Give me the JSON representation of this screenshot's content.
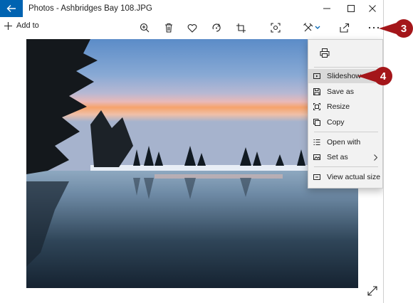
{
  "window": {
    "title": "Photos - Ashbridges Bay 108.JPG"
  },
  "toolbar": {
    "add_to_label": "Add to",
    "icons": [
      "zoom-in-icon",
      "delete-icon",
      "favorite-icon",
      "rotate-icon",
      "crop-icon",
      "enhance-icon",
      "edit-icon",
      "share-icon",
      "more-icon"
    ]
  },
  "menu": {
    "items": [
      {
        "label": "Slideshow",
        "icon": "slideshow-icon"
      },
      {
        "label": "Save as",
        "icon": "save-icon"
      },
      {
        "label": "Resize",
        "icon": "resize-icon"
      },
      {
        "label": "Copy",
        "icon": "copy-icon"
      },
      {
        "label": "Open with",
        "icon": "open-with-icon"
      },
      {
        "label": "Set as",
        "icon": "set-as-icon"
      },
      {
        "label": "View actual size",
        "icon": "actual-size-icon"
      }
    ],
    "highlighted_item": "Slideshow"
  },
  "callouts": {
    "more": "3",
    "slideshow": "4"
  },
  "colors": {
    "accent": "#0063b1",
    "callout": "#a4161a",
    "menu_highlight": "#d9d9d9"
  }
}
